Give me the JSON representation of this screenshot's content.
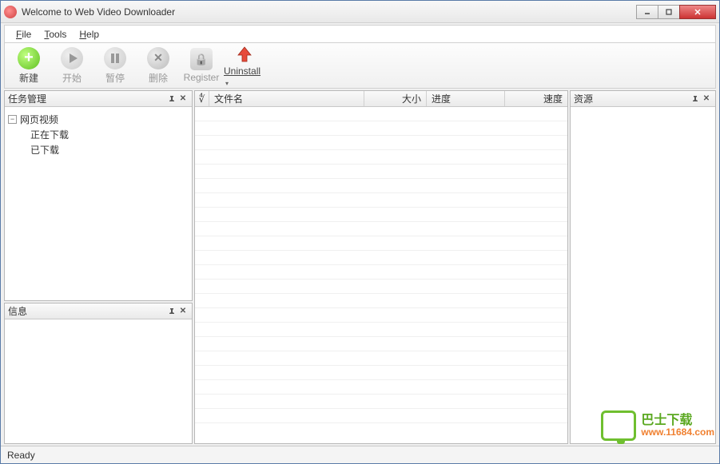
{
  "window": {
    "title": "Welcome to Web Video Downloader"
  },
  "menus": {
    "file": "File",
    "tools": "Tools",
    "help": "Help"
  },
  "toolbar": {
    "new": "新建",
    "start": "开始",
    "pause": "暂停",
    "delete": "删除",
    "register": "Register",
    "uninstall": "Uninstall"
  },
  "panels": {
    "task_mgmt": "任务管理",
    "info": "信息",
    "resources": "资源"
  },
  "tree": {
    "root": "网页视频",
    "children": {
      "downloading": "正在下载",
      "downloaded": "已下载"
    }
  },
  "columns": {
    "handle": "∜",
    "filename": "文件名",
    "size": "大小",
    "progress": "进度",
    "speed": "速度"
  },
  "status": {
    "text": "Ready"
  },
  "watermark": {
    "cn": "巴士下载",
    "url": "www.11684.com"
  }
}
